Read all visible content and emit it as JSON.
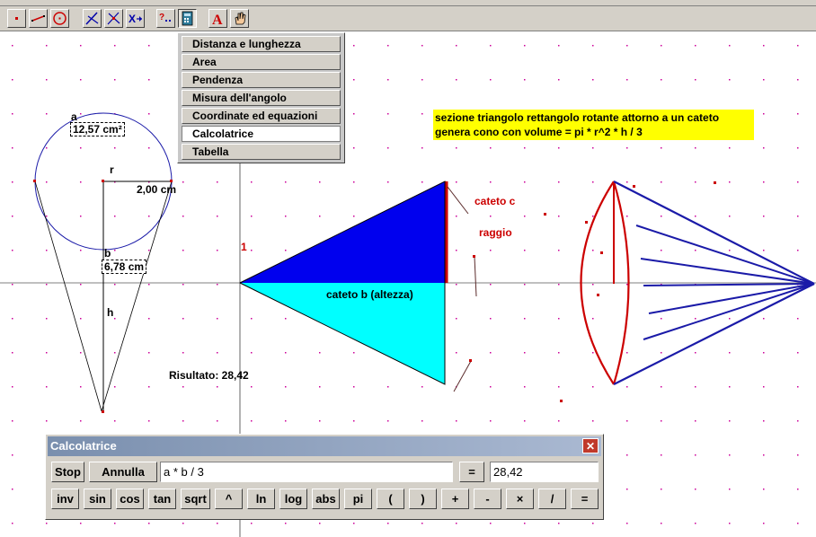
{
  "toolbar": {
    "tools": [
      {
        "name": "point-tool-icon",
        "color": "#cc0000"
      },
      {
        "name": "segment-tool-icon",
        "color": "#cc0000"
      },
      {
        "name": "circle-tool-icon",
        "color": "#cc0000"
      },
      {
        "name": "perpendicular-tool-icon",
        "color": "#0000aa"
      },
      {
        "name": "intersection-tool-icon",
        "color": "#0000aa"
      },
      {
        "name": "transform-tool-icon",
        "color": "#0000aa"
      },
      {
        "name": "macro-tool-icon",
        "color": "#0000aa"
      },
      {
        "name": "calculator-tool-icon",
        "color": "#0000aa"
      },
      {
        "name": "text-tool-icon",
        "color": "#cc0000"
      },
      {
        "name": "hand-tool-icon",
        "color": "#cc0000"
      }
    ]
  },
  "measure_menu": {
    "items": [
      "Distanza e lunghezza",
      "Area",
      "Pendenza",
      "Misura dell'angolo",
      "Coordinate ed equazioni",
      "Calcolatrice",
      "Tabella"
    ],
    "selected_index": 5
  },
  "note": {
    "line1": "sezione triangolo rettangolo rotante attorno a un cateto",
    "line2": "genera cono con volume = pi * r^2 * h / 3"
  },
  "figure_labels": {
    "a": "a",
    "area_value": "12,57  cm²",
    "r": "r",
    "radius_value": "2,00  cm",
    "b": "b",
    "height_value": "6,78  cm",
    "h": "h",
    "axis_one": "1",
    "result": "Risultato: 28,42",
    "cateto_c": "cateto c",
    "raggio": "raggio",
    "cateto_b": "cateto b (altezza)"
  },
  "calculator": {
    "title": "Calcolatrice",
    "close": "✕",
    "stop": "Stop",
    "cancel": "Annulla",
    "expression": "a * b / 3",
    "equals": "=",
    "result": "28,42",
    "keys": [
      "inv",
      "sin",
      "cos",
      "tan",
      "sqrt",
      "^",
      "ln",
      "log",
      "abs",
      "pi",
      "(",
      ")",
      "+",
      "-",
      "×",
      "/",
      "="
    ]
  },
  "colors": {
    "dark_blue_fill": "#0000ee",
    "cyan_fill": "#00ffff",
    "red_line": "#cc0000",
    "blue_line": "#1a1aa8",
    "grid_dot": "#cc0099",
    "note_bg": "#ffff00"
  }
}
